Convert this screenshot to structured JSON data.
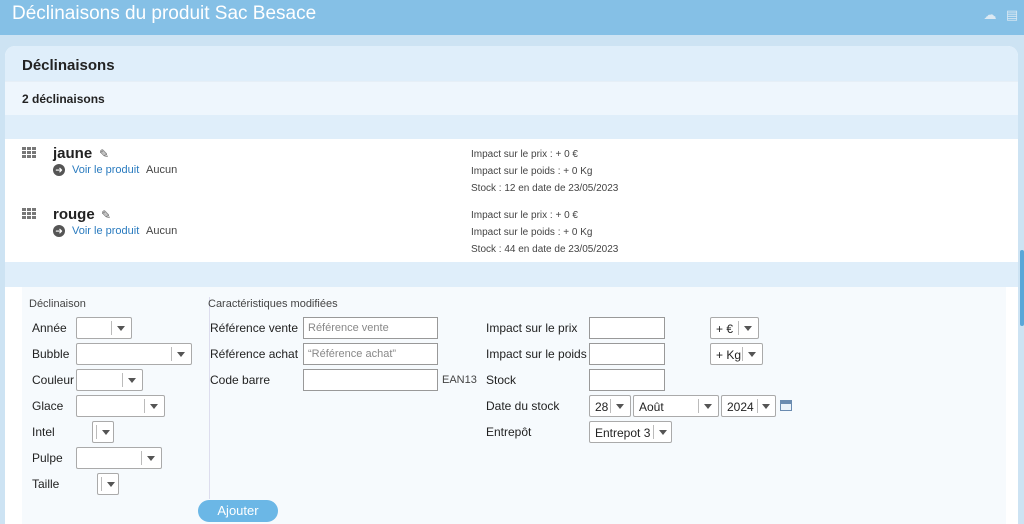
{
  "header": {
    "title": "Déclinaisons du produit Sac Besace",
    "icons": [
      "cloud-download-icon",
      "printer-icon"
    ]
  },
  "panel": {
    "title": "Déclinaisons",
    "count": "2 déclinaisons"
  },
  "variants": [
    {
      "name": "jaune",
      "link": "Voir le produit",
      "link_suffix": "Aucun",
      "price": "Impact sur le prix : + 0 €",
      "weight": "Impact sur le poids : + 0 Kg",
      "stock": "Stock : 12 en date de 23/05/2023"
    },
    {
      "name": "rouge",
      "link": "Voir le produit",
      "link_suffix": "Aucun",
      "price": "Impact sur le prix : + 0 €",
      "weight": "Impact sur le poids : + 0 Kg",
      "stock": "Stock : 44 en date de 23/05/2023"
    }
  ],
  "form": {
    "declinaison_header": "Déclinaison",
    "attrs": [
      "Année",
      "Bubble",
      "Couleur",
      "Glace",
      "Intel",
      "Pulpe",
      "Taille"
    ],
    "char_header": "Caractéristiques modifiées",
    "ref_vente_label": "Référence vente",
    "ref_vente_placeholder": "Référence vente",
    "ref_achat_label": "Référence achat",
    "ref_achat_placeholder": "“Référence achat”",
    "barcode_label": "Code barre",
    "barcode_type": "EAN13",
    "price_impact_label": "Impact sur le prix",
    "price_unit": "+ €",
    "weight_impact_label": "Impact sur le poids",
    "weight_unit": "+ Kg",
    "stock_label": "Stock",
    "stock_date_label": "Date du stock",
    "day": "28",
    "month": "Août",
    "year": "2024",
    "warehouse_label": "Entrepôt",
    "warehouse": "Entrepot 3",
    "add_button": "Ajouter"
  }
}
